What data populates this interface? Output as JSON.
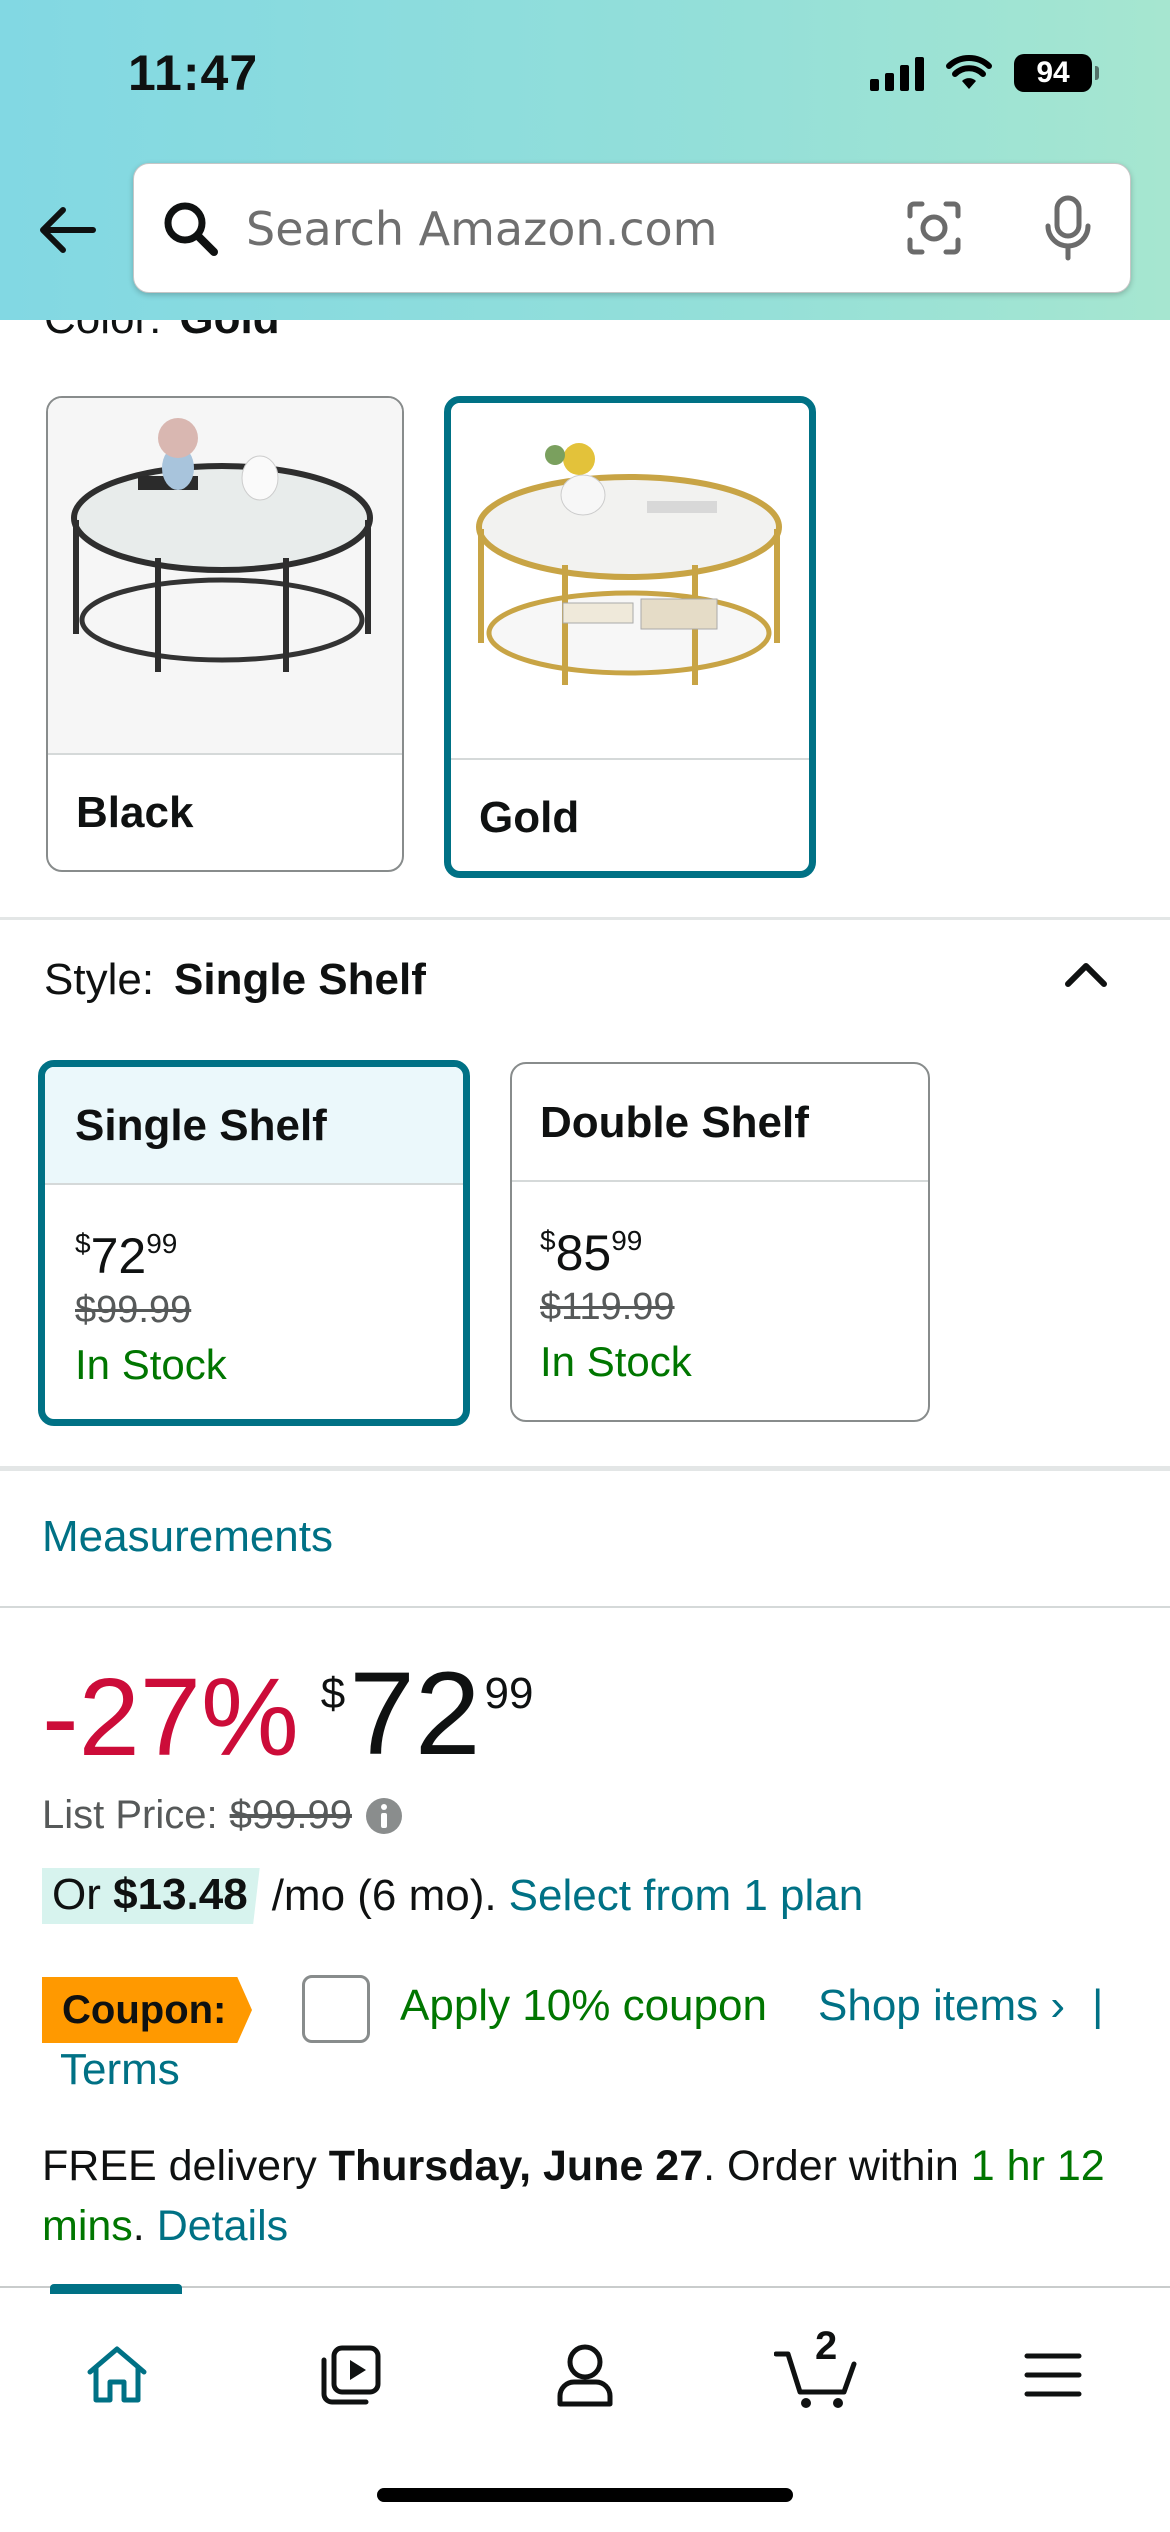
{
  "status_bar": {
    "time": "11:47",
    "battery": "94"
  },
  "search": {
    "placeholder": "Search Amazon.com"
  },
  "color": {
    "label": "Color:",
    "selected": "Gold",
    "options": [
      {
        "name": "Black",
        "selected": false
      },
      {
        "name": "Gold",
        "selected": true
      }
    ]
  },
  "style": {
    "label": "Style:",
    "selected": "Single Shelf",
    "options": [
      {
        "name": "Single Shelf",
        "price_whole": "72",
        "price_fraction": "99",
        "currency": "$",
        "list_price": "$99.99",
        "stock": "In Stock",
        "selected": true
      },
      {
        "name": "Double Shelf",
        "price_whole": "85",
        "price_fraction": "99",
        "currency": "$",
        "list_price": "$119.99",
        "stock": "In Stock",
        "selected": false
      }
    ]
  },
  "measurements_link": "Measurements",
  "price": {
    "discount": "-27%",
    "currency": "$",
    "whole": "72",
    "fraction": "99",
    "list_price_label": "List Price:",
    "list_price": "$99.99"
  },
  "installment": {
    "prefix": "Or",
    "amount": "$13.48",
    "term": "/mo (6 mo).",
    "link": "Select from 1 plan"
  },
  "coupon": {
    "badge": "Coupon:",
    "text": "Apply 10% coupon",
    "shop_items": "Shop items ›",
    "separator": "|",
    "terms": "Terms"
  },
  "delivery": {
    "prefix": "FREE delivery",
    "date": "Thursday, June 27",
    "order_within": ". Order within",
    "countdown": "1 hr 12 mins",
    "dot": ".",
    "details": "Details"
  },
  "bottom_nav": {
    "cart_count": "2"
  },
  "colors": {
    "accent": "#007185",
    "deal_red": "#cc0c39",
    "stock_green": "#007600",
    "coupon_orange": "#ff9900"
  }
}
